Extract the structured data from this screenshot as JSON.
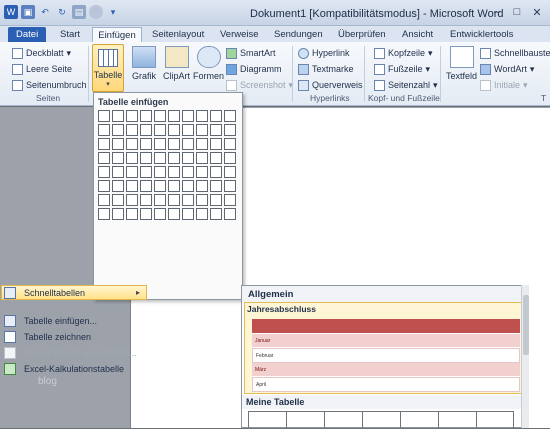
{
  "window": {
    "title": "Dokument1 [Kompatibilitätsmodus] - Microsoft Word",
    "controls": [
      "–",
      "□",
      "✕"
    ]
  },
  "tabs": [
    "Datei",
    "Start",
    "Einfügen",
    "Seitenlayout",
    "Verweise",
    "Sendungen",
    "Überprüfen",
    "Ansicht",
    "Entwicklertools"
  ],
  "ribbon": {
    "seiten": {
      "items": [
        "Deckblatt",
        "Leere Seite",
        "Seitenumbruch"
      ],
      "label": "Seiten"
    },
    "tabellen": {
      "big_label": "Tabelle"
    },
    "illustrationen": {
      "big": [
        "Grafik",
        "ClipArt",
        "Formen"
      ],
      "small": [
        "SmartArt",
        "Diagramm",
        "Screenshot"
      ]
    },
    "hyperlinks": {
      "items": [
        "Hyperlink",
        "Textmarke",
        "Querverweis"
      ],
      "label": "Hyperlinks"
    },
    "kopfzeile": {
      "items": [
        "Kopfzeile",
        "Fußzeile",
        "Seitenzahl"
      ],
      "label": "Kopf- und Fußzeile"
    },
    "text": {
      "big": "Textfeld",
      "small": [
        "Schnellbaustei",
        "WordArt",
        "Initiale"
      ],
      "label": "T"
    }
  },
  "dropdown": {
    "header": "Tabelle einfügen",
    "grid_cols": 10,
    "grid_rows": 8,
    "items": [
      {
        "label": "Tabelle einfügen...",
        "disabled": false
      },
      {
        "label": "Tabelle zeichnen",
        "disabled": false
      },
      {
        "label": "Text in Tabelle umwandeln...",
        "disabled": true
      },
      {
        "label": "Excel-Kalkulationstabelle",
        "disabled": false
      },
      {
        "label": "Schnelltabellen",
        "disabled": false,
        "hover": true,
        "submenu": true
      }
    ]
  },
  "submenu": {
    "header": "Allgemein",
    "template1": {
      "title": "Jahresabschluss",
      "rows": [
        "",
        "Januar",
        "Februar",
        "März",
        "April"
      ]
    },
    "template2": {
      "title": "Meine Tabelle"
    }
  },
  "watermark": "blog",
  "colors": {
    "accent": "#2b5fb4",
    "highlight": "#ffd77a",
    "table_head": "#c0504d",
    "table_pink": "#f2d0d0"
  }
}
